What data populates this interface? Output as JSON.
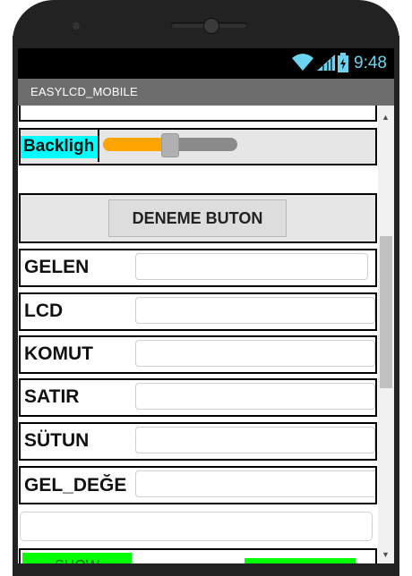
{
  "status_bar": {
    "time": "9:48",
    "icons": [
      "wifi-icon",
      "signal-icon",
      "battery-icon"
    ],
    "time_color": "#6cd3f0"
  },
  "app": {
    "title": "EASYLCD_MOBILE",
    "titlebar_color": "#6d6d6d"
  },
  "backlight": {
    "label": "Backligh",
    "label_bg": "#00ffff",
    "slider_fill_color": "#ffa500",
    "slider_value": 0.4
  },
  "test_button": {
    "label": "DENEME BUTON"
  },
  "fields": [
    {
      "label": "GELEN",
      "value": ""
    },
    {
      "label": "LCD",
      "value": ""
    },
    {
      "label": "KOMUT",
      "value": ""
    },
    {
      "label": "SATIR",
      "value": ""
    },
    {
      "label": "SÜTUN",
      "value": ""
    },
    {
      "label": "GEL_DEĞE",
      "value": ""
    }
  ],
  "bottom_input": {
    "value": ""
  },
  "bottom_buttons": {
    "show_label": "SHOW",
    "color": "#00ff00"
  }
}
